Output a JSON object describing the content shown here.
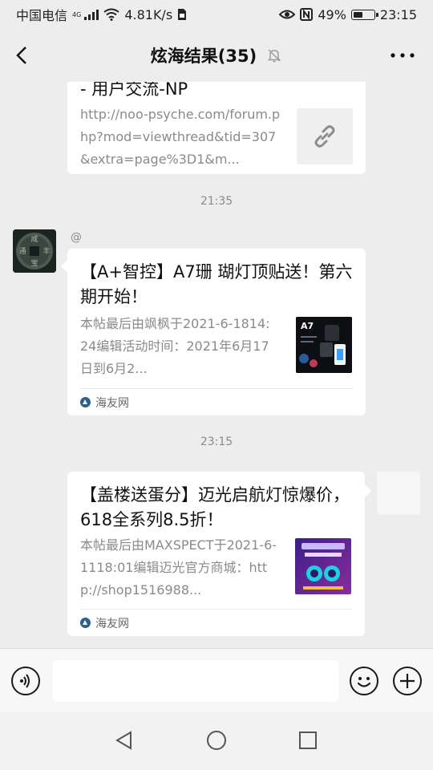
{
  "status_bar": {
    "carrier": "中国电信",
    "network": "4G",
    "speed": "4.81K/s",
    "battery": "49%",
    "battery_level": 0.49,
    "time": "23:15"
  },
  "header": {
    "title": "炫海结果(35)"
  },
  "messages": [
    {
      "title": "- 用户交流-NP",
      "desc": "http://noo-psyche.com/forum.php?mod=viewthread&tid=307&extra=page%3D1&m..."
    },
    {
      "time": "21:35"
    },
    {
      "sender": "@",
      "title": "【A+智控】A7珊 瑚灯顶贴送！第六期开始！",
      "desc": "本帖最后由飒枫于2021-6-1814:24编辑活动时间：2021年6月17日到6月2...",
      "source": "海友网",
      "thumb_text": "A7"
    },
    {
      "time": "23:15"
    },
    {
      "title": "【盖楼送蛋分】迈光启航灯惊爆价，618全系列8.5折！",
      "desc": "本帖最后由MAXSPECT于2021-6-1118:01编辑迈光官方商城：http://shop1516988...",
      "source": "海友网"
    }
  ],
  "input": {
    "value": ""
  }
}
